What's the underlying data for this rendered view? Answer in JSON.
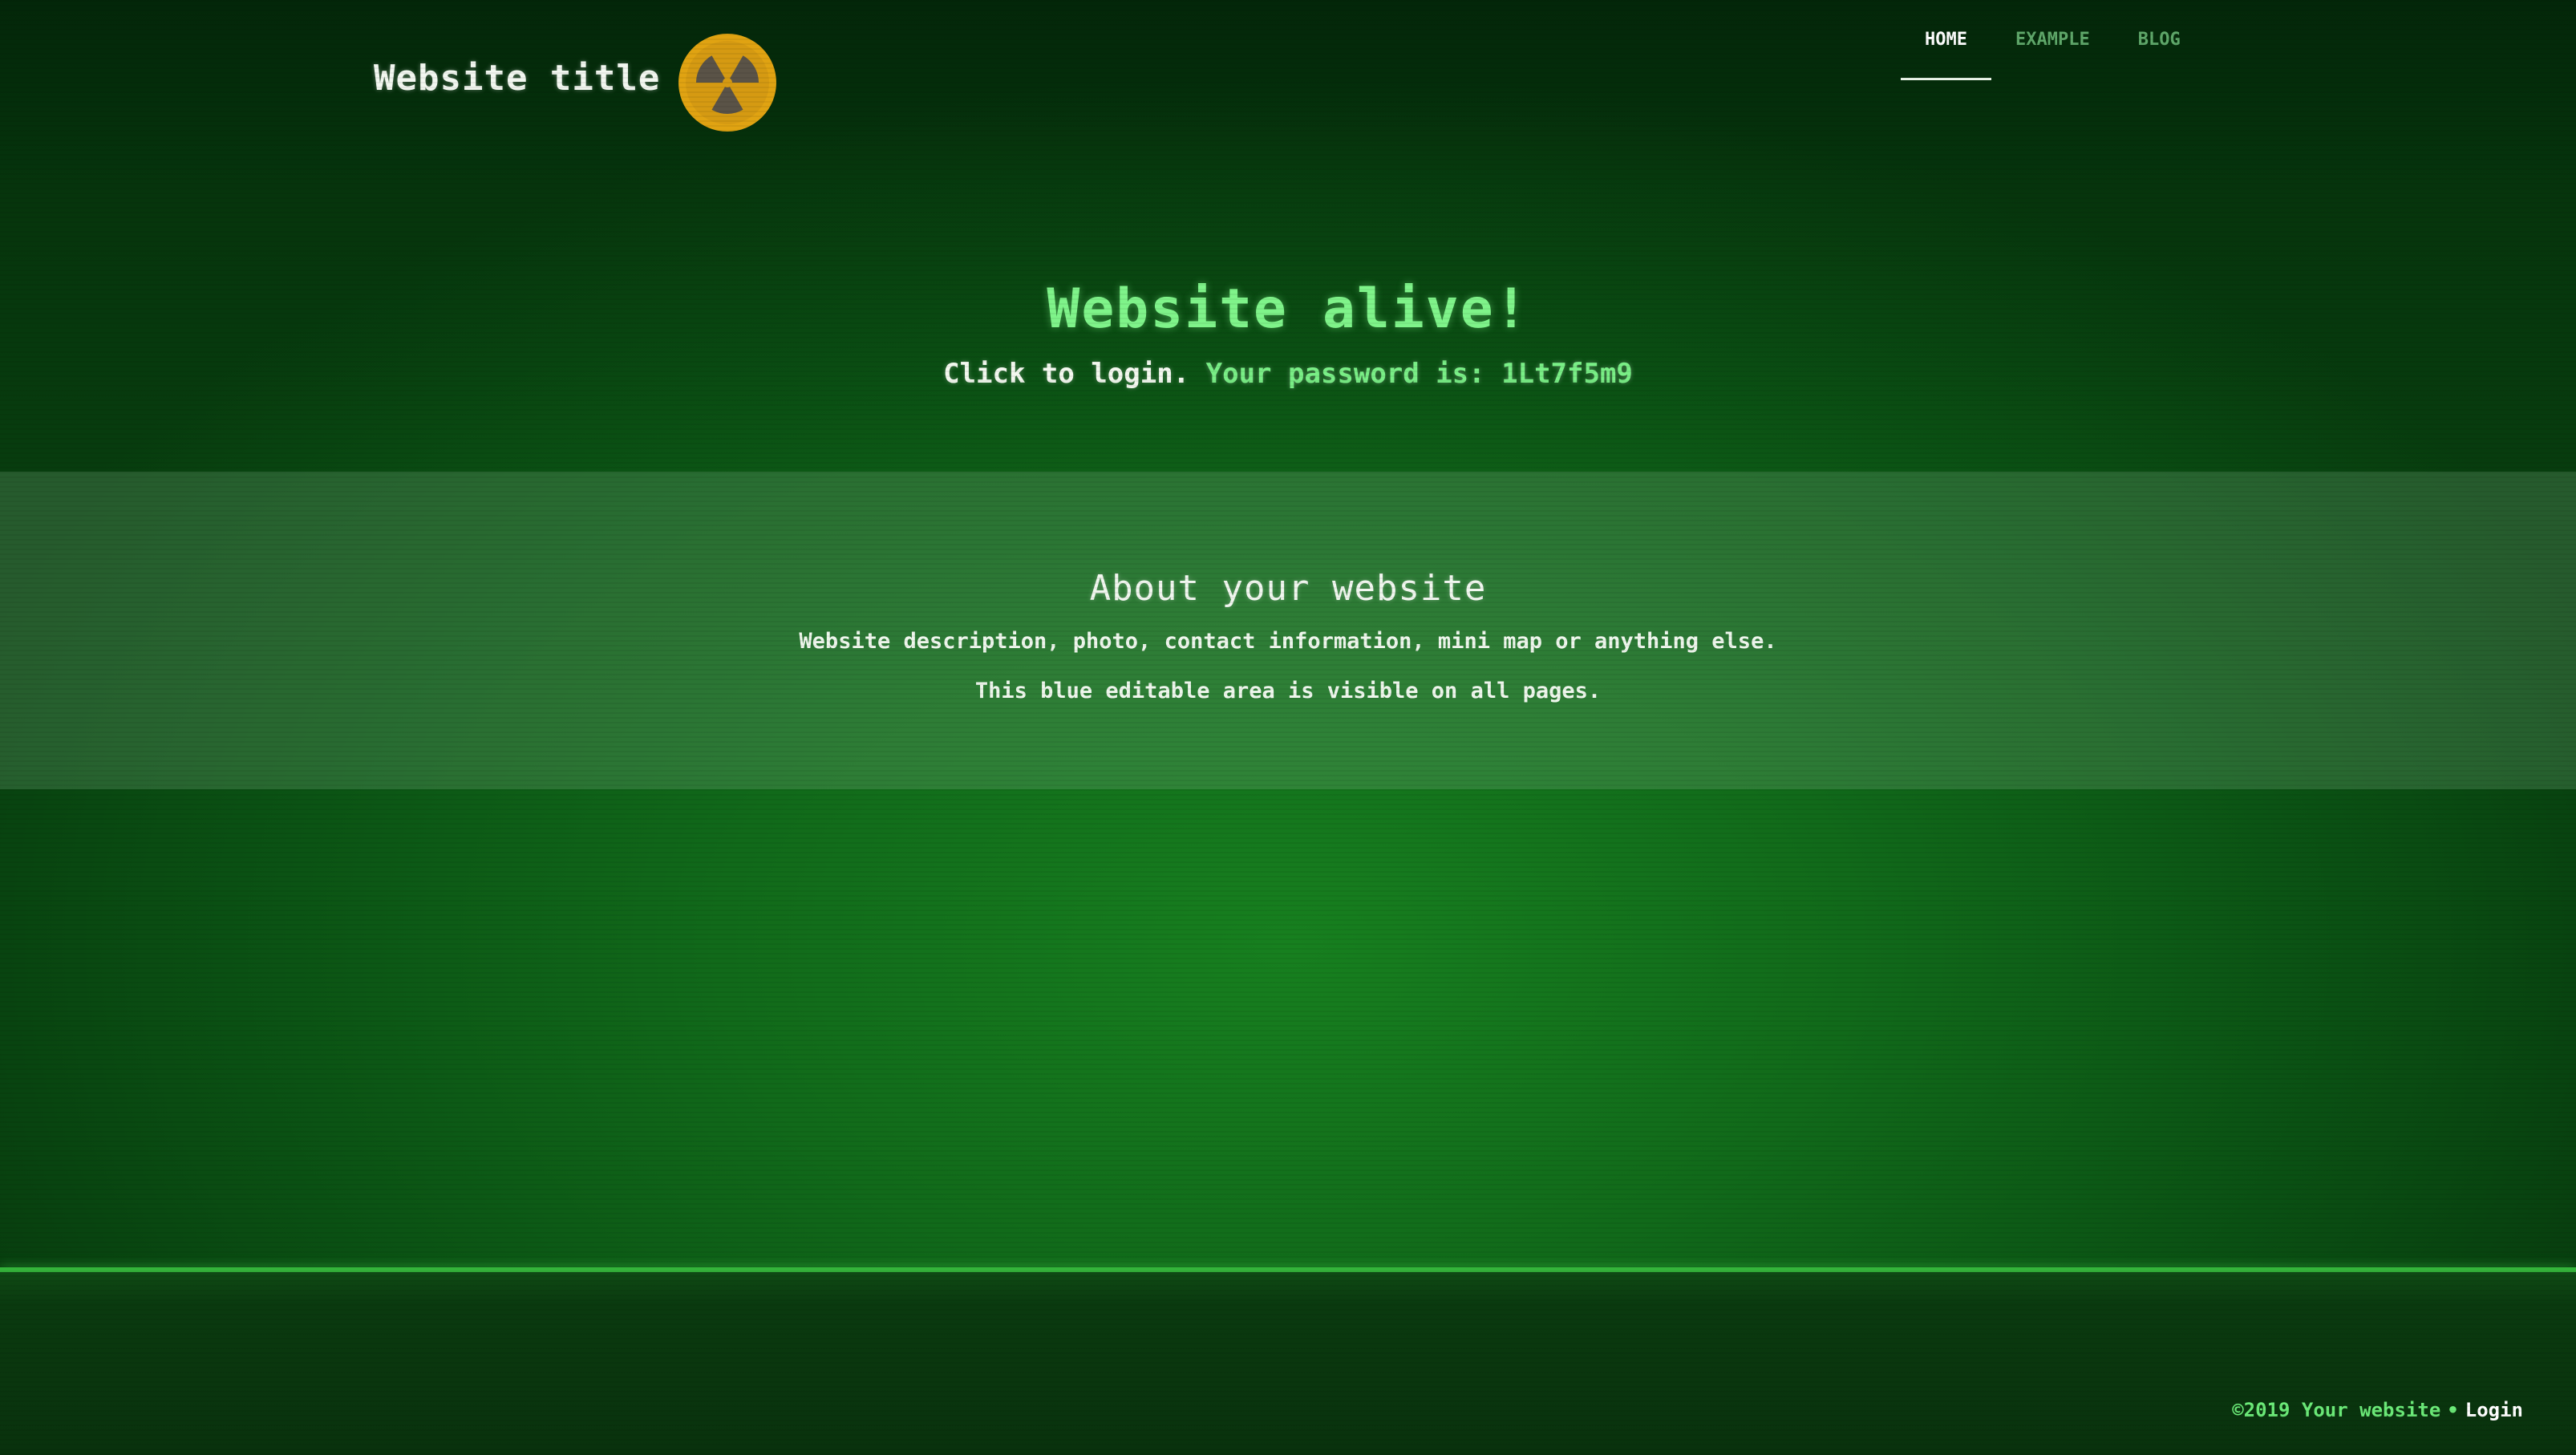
{
  "header": {
    "site_title": "Website title",
    "logo_icon": "radiation-icon",
    "nav": [
      {
        "label": "HOME",
        "active": true
      },
      {
        "label": "EXAMPLE",
        "active": false
      },
      {
        "label": "BLOG",
        "active": false
      }
    ]
  },
  "hero": {
    "heading": "Website alive!",
    "login_text": "Click to login.",
    "password_label": "Your password is:",
    "password_value": "1Lt7f5m9"
  },
  "about": {
    "title": "About your website",
    "line1": "Website description, photo, contact information, mini map or anything else.",
    "line2": "This blue editable area is visible on all pages."
  },
  "footer": {
    "copyright": "©2019 Your website",
    "separator": "•",
    "login_label": "Login"
  },
  "colors": {
    "background": "#116a1a",
    "accent_green": "#7ff48a",
    "logo_yellow": "#e0a312",
    "logo_dark": "#5a5347",
    "footer_line": "#34b43a"
  }
}
